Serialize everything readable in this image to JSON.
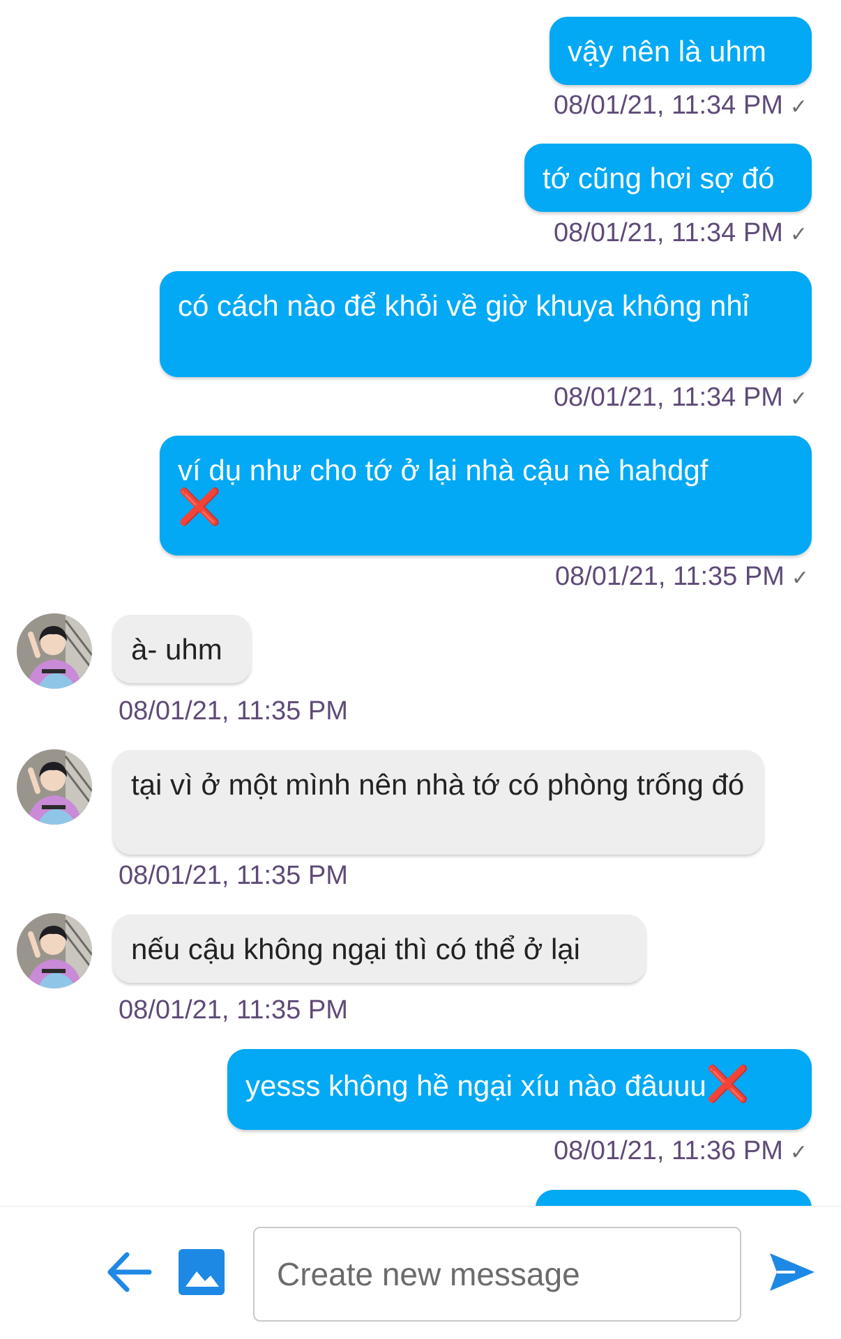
{
  "colors": {
    "outgoing_bubble": "#03a9f4",
    "incoming_bubble": "#eeeeee",
    "timestamp": "#5e4a78",
    "accent": "#1e88e5",
    "error_mark": "#e0141e"
  },
  "messages": [
    {
      "direction": "out",
      "text": "vậy nên là uhm",
      "time": "08/01/21, 11:34 PM",
      "status": "sent-check-icon"
    },
    {
      "direction": "out",
      "text": "tớ cũng hơi sợ đó",
      "time": "08/01/21, 11:34 PM",
      "status": "sent-check-icon"
    },
    {
      "direction": "out",
      "text": "có cách nào để khỏi về giờ khuya không nhỉ",
      "time": "08/01/21, 11:34 PM",
      "status": "sent-check-icon"
    },
    {
      "direction": "out",
      "text": "ví dụ như cho tớ ở lại nhà cậu nè hahdgf",
      "mark": "❌",
      "time": "08/01/21, 11:35 PM",
      "status": "sent-check-icon"
    },
    {
      "direction": "in",
      "text": "à- uhm",
      "time": "08/01/21, 11:35 PM",
      "avatar": "avatar-icon"
    },
    {
      "direction": "in",
      "text": "tại vì ở một mình nên nhà tớ có phòng trống đó",
      "time": "08/01/21, 11:35 PM",
      "avatar": "avatar-icon"
    },
    {
      "direction": "in",
      "text": "nếu cậu không ngại thì có thể ở lại",
      "time": "08/01/21, 11:35 PM",
      "avatar": "avatar-icon"
    },
    {
      "direction": "out",
      "text": "yesss không hề ngại xíu nào đâuuu",
      "mark": "❌",
      "time": "08/01/21, 11:36 PM",
      "status": "sent-check-icon"
    }
  ],
  "composer": {
    "placeholder": "Create new message",
    "back_icon": "arrow-left-icon",
    "image_icon": "image-icon",
    "send_icon": "send-icon"
  }
}
